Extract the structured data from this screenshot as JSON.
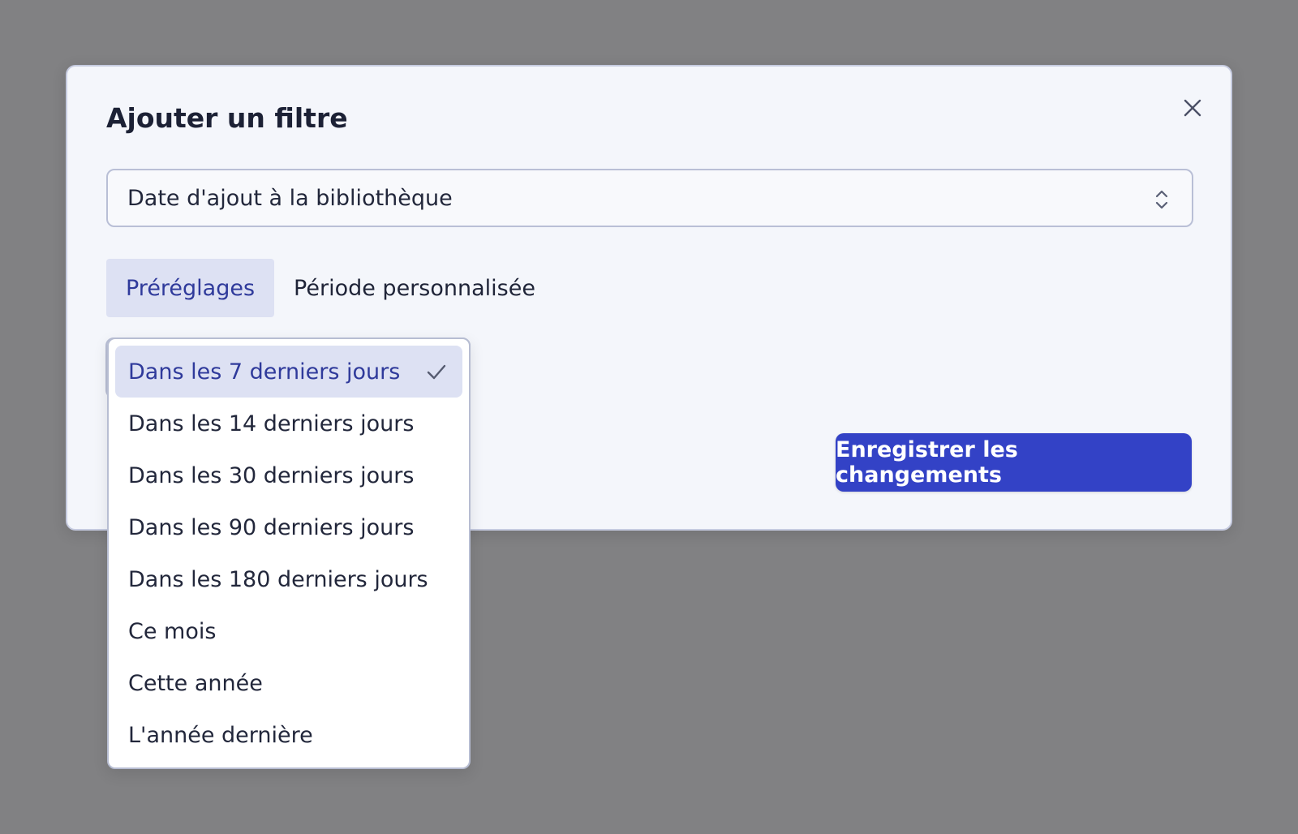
{
  "modal": {
    "title": "Ajouter un filtre",
    "close_icon": "close-icon",
    "field_select": {
      "value": "Date d'ajout à la bibliothèque",
      "icon": "chevron-up-down-icon"
    },
    "tabs": [
      {
        "label": "Préréglages",
        "active": true
      },
      {
        "label": "Période personnalisée",
        "active": false
      }
    ],
    "save_label": "Enregistrer les changements"
  },
  "preset_dropdown": {
    "options": [
      {
        "label": "Dans les 7 derniers jours",
        "selected": true
      },
      {
        "label": "Dans les 14 derniers jours",
        "selected": false
      },
      {
        "label": "Dans les 30 derniers jours",
        "selected": false
      },
      {
        "label": "Dans les 90 derniers jours",
        "selected": false
      },
      {
        "label": "Dans les 180 derniers jours",
        "selected": false
      },
      {
        "label": "Ce mois",
        "selected": false
      },
      {
        "label": "Cette année",
        "selected": false
      },
      {
        "label": "L'année dernière",
        "selected": false
      }
    ],
    "check_icon": "check-icon"
  },
  "colors": {
    "overlay": "#818183",
    "modal_bg": "#f4f6fb",
    "accent": "#3342c6",
    "active_tab_bg": "#dde1f3",
    "active_text": "#2f3a9b"
  }
}
